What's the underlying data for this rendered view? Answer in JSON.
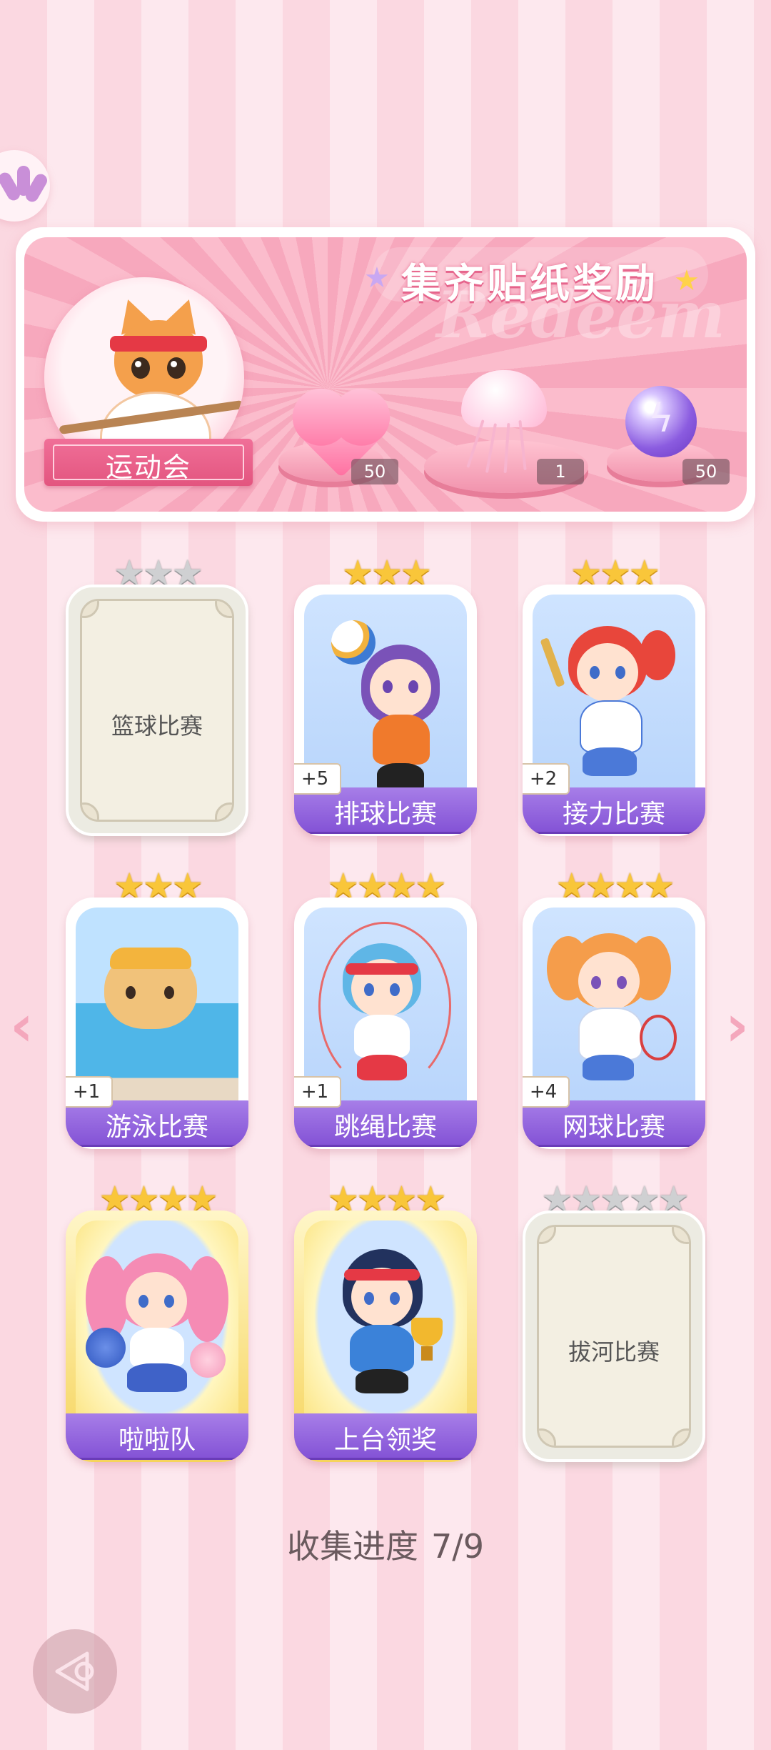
{
  "banner": {
    "title": "集齐贴纸奖励",
    "watermark": "Redeem",
    "event_name": "运动会",
    "rewards": [
      {
        "icon": "pink-heart-gem-icon",
        "count": "50"
      },
      {
        "icon": "jellyfish-plush-icon",
        "count": "1"
      },
      {
        "icon": "energy-orb-icon",
        "count": "50"
      }
    ]
  },
  "cards": [
    {
      "name": "篮球比赛",
      "stars": "★★★",
      "star_color": "silver",
      "locked": true,
      "bonus": ""
    },
    {
      "name": "排球比赛",
      "stars": "★★★",
      "star_color": "gold",
      "locked": false,
      "bonus": "+5"
    },
    {
      "name": "接力比赛",
      "stars": "★★★",
      "star_color": "gold",
      "locked": false,
      "bonus": "+2"
    },
    {
      "name": "游泳比赛",
      "stars": "★★★",
      "star_color": "gold",
      "locked": false,
      "bonus": "+1"
    },
    {
      "name": "跳绳比赛",
      "stars": "★★★★",
      "star_color": "gold",
      "locked": false,
      "bonus": "+1"
    },
    {
      "name": "网球比赛",
      "stars": "★★★★",
      "star_color": "gold",
      "locked": false,
      "bonus": "+4"
    },
    {
      "name": "啦啦队",
      "stars": "★★★★",
      "star_color": "gold",
      "locked": false,
      "bonus": ""
    },
    {
      "name": "上台领奖",
      "stars": "★★★★",
      "star_color": "gold",
      "locked": false,
      "bonus": ""
    },
    {
      "name": "拔河比赛",
      "stars": "★★★★★",
      "star_color": "silver",
      "locked": true,
      "bonus": ""
    }
  ],
  "progress": {
    "label": "收集进度",
    "value": "7/9"
  },
  "nav": {
    "prev_icon": "chevron-left-icon",
    "next_icon": "chevron-right-icon",
    "back_icon": "back-arrow-icon"
  },
  "colors": {
    "accent_pink": "#f06f98",
    "name_bar_purple": "#8453d6",
    "star_gold": "#f9c63a",
    "star_silver": "#cfd0d2"
  }
}
